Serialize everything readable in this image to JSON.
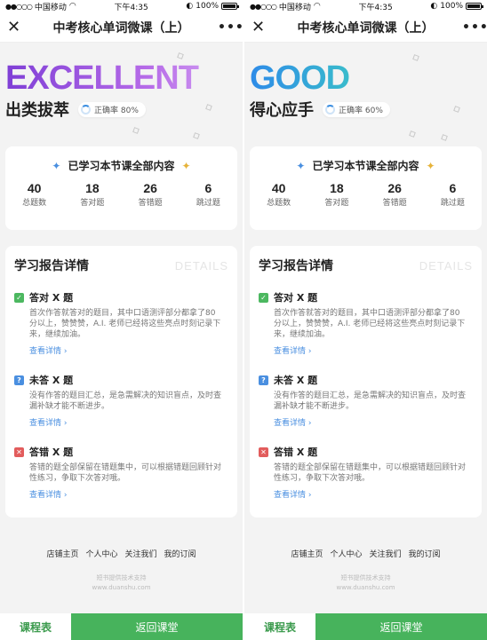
{
  "screens": [
    {
      "status": {
        "carrier": "中国移动",
        "time": "下午4:35",
        "battery": "100%"
      },
      "nav": {
        "close": "✕",
        "title": "中考核心单词微课（上）",
        "more": "•••"
      },
      "hero": {
        "grade": "EXCELLENT",
        "label": "出类拔萃",
        "rate": "正确率 80%"
      },
      "summary": {
        "title": "已学习本节课全部内容",
        "stats": [
          {
            "value": "40",
            "label": "总题数"
          },
          {
            "value": "18",
            "label": "答对题"
          },
          {
            "value": "26",
            "label": "答错题"
          },
          {
            "value": "6",
            "label": "跳过题"
          }
        ]
      },
      "details": {
        "title": "学习报告详情",
        "en": "DETAILS",
        "items": [
          {
            "icon": "✓",
            "title": "答对 X 题",
            "desc": "首次作答就答对的题目，其中口语测评部分都拿了80分以上，赞赞赞，A.I. 老师已经将这些亮点时刻记录下来，继续加油。",
            "link": "查看详情 ›",
            "color": "#4cb860"
          },
          {
            "icon": "?",
            "title": "未答 X 题",
            "desc": "没有作答的题目汇总，是急需解决的知识盲点，及时查漏补缺才能不断进步。",
            "link": "查看详情 ›",
            "color": "#4a8fe0"
          },
          {
            "icon": "✕",
            "title": "答错 X 题",
            "desc": "答错的题全部保留在错题集中，可以根据错题回顾针对性练习，争取下次答对哦。",
            "link": "查看详情 ›",
            "color": "#e25c5c"
          }
        ]
      },
      "footer": {
        "links": [
          "店铺主页",
          "个人中心",
          "关注我们",
          "我的订阅"
        ],
        "powered": "短书提供技术支持",
        "domain": "www.duanshu.com"
      },
      "bottom": {
        "schedule": "课程表",
        "return": "返回课堂"
      }
    },
    {
      "status": {
        "carrier": "中国移动",
        "time": "下午4:35",
        "battery": "100%"
      },
      "nav": {
        "close": "✕",
        "title": "中考核心单词微课（上）",
        "more": "•••"
      },
      "hero": {
        "grade": "GOOD",
        "label": "得心应手",
        "rate": "正确率 60%"
      },
      "summary": {
        "title": "已学习本节课全部内容",
        "stats": [
          {
            "value": "40",
            "label": "总题数"
          },
          {
            "value": "18",
            "label": "答对题"
          },
          {
            "value": "26",
            "label": "答错题"
          },
          {
            "value": "6",
            "label": "跳过题"
          }
        ]
      },
      "details": {
        "title": "学习报告详情",
        "en": "DETAILS",
        "items": [
          {
            "icon": "✓",
            "title": "答对 X 题",
            "desc": "首次作答就答对的题目，其中口语测评部分都拿了80分以上，赞赞赞，A.I. 老师已经将这些亮点时刻记录下来，继续加油。",
            "link": "查看详情 ›",
            "color": "#4cb860"
          },
          {
            "icon": "?",
            "title": "未答 X 题",
            "desc": "没有作答的题目汇总，是急需解决的知识盲点，及时查漏补缺才能不断进步。",
            "link": "查看详情 ›",
            "color": "#4a8fe0"
          },
          {
            "icon": "✕",
            "title": "答错 X 题",
            "desc": "答错的题全部保留在错题集中，可以根据错题回顾针对性练习，争取下次答对哦。",
            "link": "查看详情 ›",
            "color": "#e25c5c"
          }
        ]
      },
      "footer": {
        "links": [
          "店铺主页",
          "个人中心",
          "关注我们",
          "我的订阅"
        ],
        "powered": "短书提供技术支持",
        "domain": "www.duanshu.com"
      },
      "bottom": {
        "schedule": "课程表",
        "return": "返回课堂"
      }
    }
  ]
}
